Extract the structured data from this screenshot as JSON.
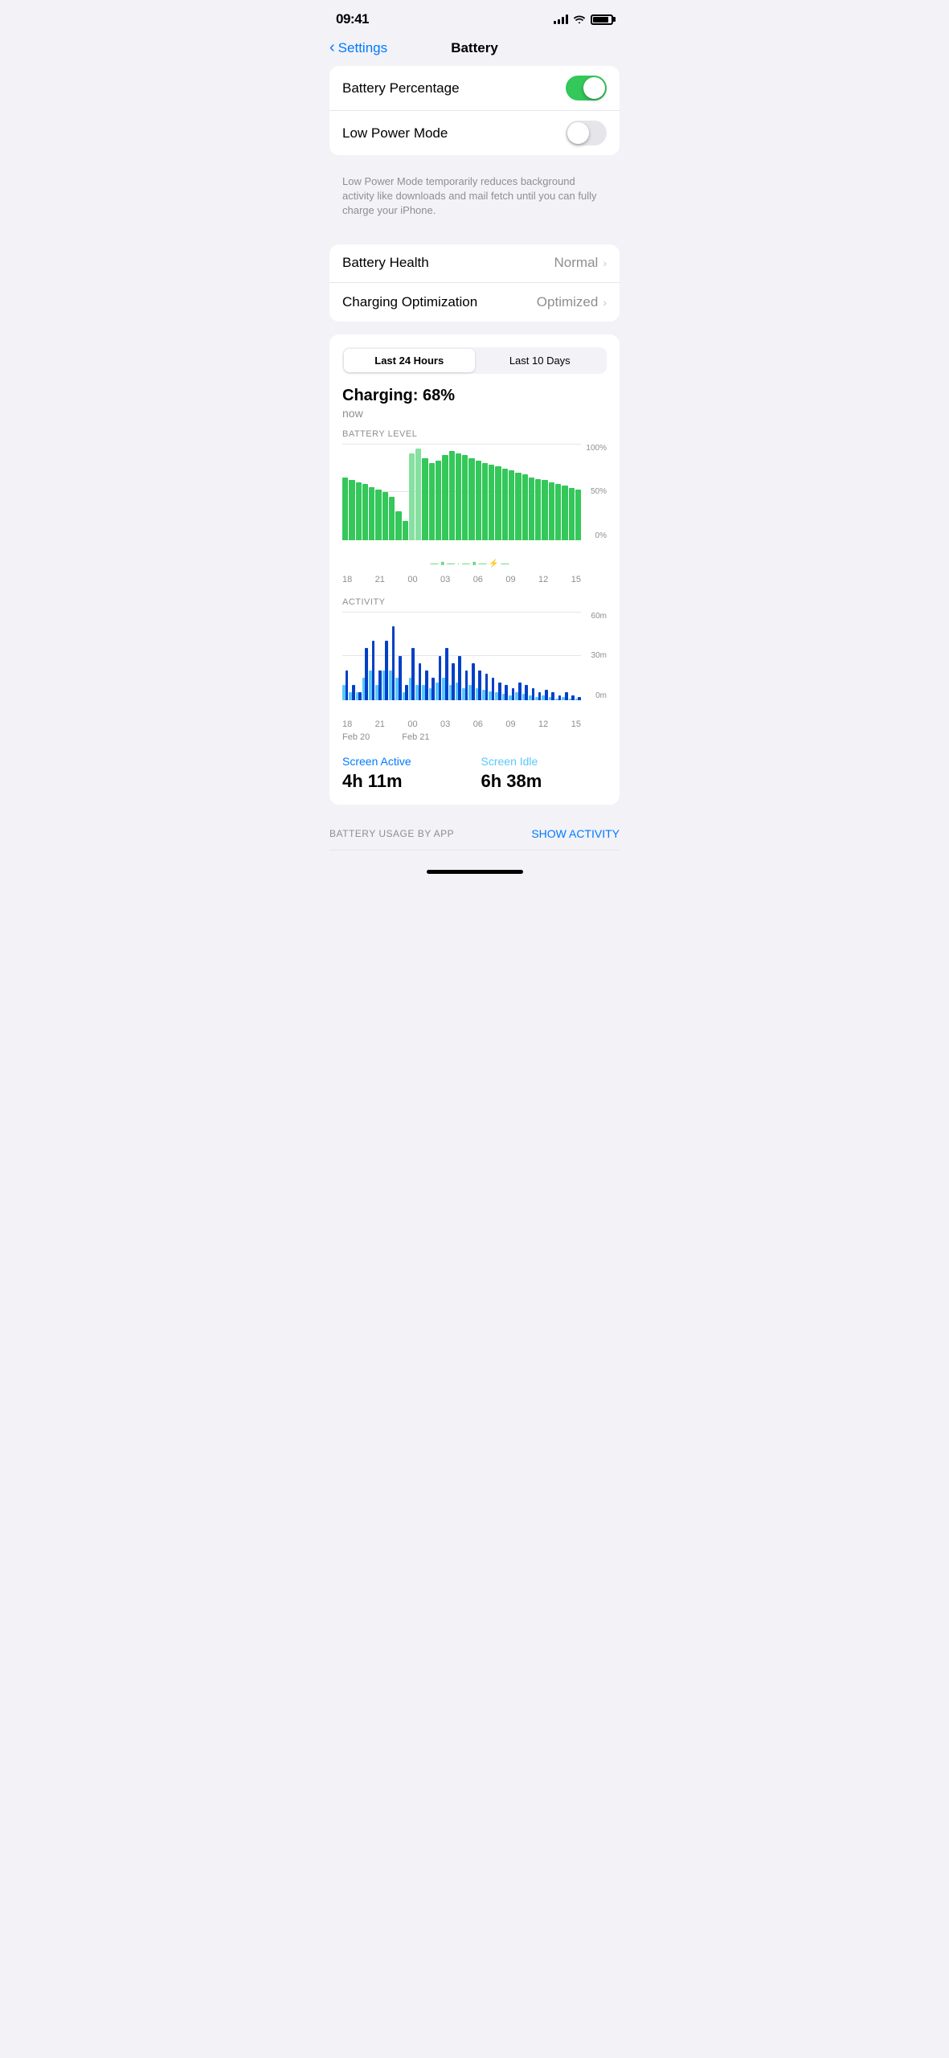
{
  "statusBar": {
    "time": "09:41",
    "battery": "battery-icon"
  },
  "header": {
    "backLabel": "Settings",
    "title": "Battery"
  },
  "settings": {
    "batteryPercentage": {
      "label": "Battery Percentage",
      "enabled": true
    },
    "lowPowerMode": {
      "label": "Low Power Mode",
      "enabled": false
    },
    "lowPowerFooter": "Low Power Mode temporarily reduces background activity like downloads and mail fetch until you can fully charge your iPhone."
  },
  "health": {
    "batteryHealthLabel": "Battery Health",
    "batteryHealthValue": "Normal",
    "chargingOptLabel": "Charging Optimization",
    "chargingOptValue": "Optimized"
  },
  "chart": {
    "tab1": "Last 24 Hours",
    "tab2": "Last 10 Days",
    "chargingStatus": "Charging: 68%",
    "chargingTime": "now",
    "batteryLevelLabel": "BATTERY LEVEL",
    "activityLabel": "ACTIVITY",
    "yLabels100": "100%",
    "yLabels50": "50%",
    "yLabels0": "0%",
    "activityY60": "60m",
    "activityY30": "30m",
    "activityY0": "0m",
    "xLabels": [
      "18",
      "21",
      "00",
      "03",
      "06",
      "09",
      "12",
      "15"
    ],
    "dateLabels": [
      "Feb 20",
      "",
      "Feb 21",
      "",
      "",
      "",
      "",
      ""
    ],
    "batteryBars": [
      65,
      62,
      60,
      58,
      55,
      52,
      50,
      45,
      30,
      20,
      40,
      75,
      85,
      80,
      82,
      88,
      92,
      90,
      88,
      85,
      82,
      80,
      78,
      76,
      74,
      72,
      70,
      68,
      65,
      63,
      62,
      60,
      58,
      56,
      54,
      52
    ],
    "chargingBars": [
      0,
      0,
      0,
      0,
      0,
      0,
      0,
      0,
      0,
      0,
      90,
      95,
      0,
      0,
      0,
      0,
      0,
      0,
      0,
      0,
      0,
      0,
      0,
      0,
      0,
      0,
      0,
      0,
      0,
      0,
      0,
      0,
      0,
      0,
      0,
      0
    ],
    "activityDark": [
      20,
      10,
      5,
      35,
      40,
      20,
      40,
      50,
      30,
      10,
      35,
      25,
      20,
      15,
      30,
      35,
      25,
      30,
      20,
      25,
      20,
      18,
      15,
      12,
      10,
      8,
      12,
      10,
      8,
      5,
      7,
      5,
      3,
      5,
      3,
      2
    ],
    "activityLight": [
      10,
      5,
      5,
      15,
      20,
      10,
      20,
      20,
      15,
      5,
      15,
      10,
      10,
      8,
      12,
      15,
      10,
      12,
      8,
      10,
      8,
      7,
      6,
      5,
      4,
      3,
      5,
      4,
      3,
      2,
      3,
      2,
      1,
      2,
      1,
      1
    ],
    "screenActiveLabel": "Screen Active",
    "screenActiveValue": "4h 11m",
    "screenIdleLabel": "Screen Idle",
    "screenIdleValue": "6h 38m"
  },
  "footer": {
    "batteryUsageLabel": "BATTERY USAGE BY APP",
    "showActivityBtn": "SHOW ACTIVITY"
  }
}
